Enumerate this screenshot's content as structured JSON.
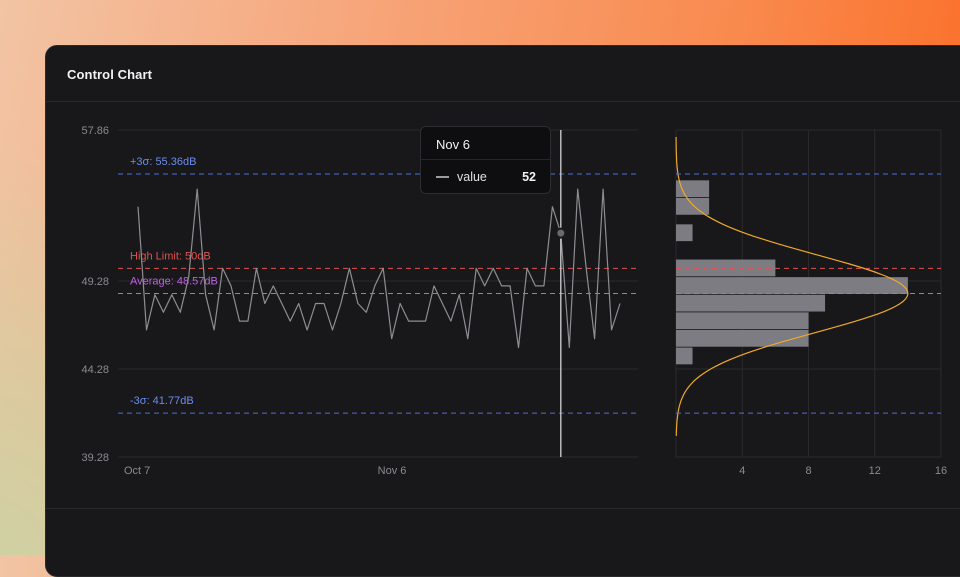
{
  "card": {
    "title": "Control Chart"
  },
  "tooltip": {
    "date": "Nov 6",
    "series": "value",
    "value": "52"
  },
  "colors": {
    "series": "#8e8e92",
    "sigma": "#4a6fe0",
    "sigma_text": "#6b8cf0",
    "high_limit": "#e0524f",
    "average": "#c25ee8",
    "bell": "#f0a92a",
    "bars": "#7c7c82",
    "grid": "#2a2a2d",
    "axis_text": "#8a8a8f"
  },
  "chart_data": [
    {
      "type": "line",
      "x_labels": [
        "Oct 7",
        "Nov 6"
      ],
      "x_label_index": [
        0,
        30
      ],
      "ylim": [
        39.28,
        57.86
      ],
      "y_ticks": [
        "57.86",
        "49.28",
        "44.28",
        "39.28"
      ],
      "y_tick_values": [
        57.86,
        49.28,
        44.28,
        39.28
      ],
      "values": [
        53.5,
        46.5,
        48.5,
        47.5,
        48.5,
        47.5,
        49.5,
        54.5,
        48.5,
        46.5,
        50.0,
        49.0,
        47.0,
        47.0,
        50.0,
        48.0,
        49.0,
        48.0,
        47.0,
        48.0,
        46.5,
        48.0,
        48.0,
        46.5,
        48.0,
        50.0,
        48.0,
        47.5,
        49.0,
        50.0,
        46.0,
        48.0,
        47.0,
        47.0,
        47.0,
        49.0,
        48.0,
        47.0,
        48.5,
        46.0,
        50.0,
        49.0,
        50.0,
        49.0,
        49.0,
        45.5,
        50.0,
        49.0,
        49.0,
        53.5,
        52.0,
        45.5,
        54.5,
        50.0,
        46.0,
        54.5,
        46.5,
        48.0
      ],
      "highlight_index": 50,
      "reference_lines": [
        {
          "label": "+3σ: 55.36dB",
          "value": 55.36,
          "kind": "sigma"
        },
        {
          "label": "High Limit: 50dB",
          "value": 50,
          "kind": "high_limit"
        },
        {
          "label": "Average: 48.57dB",
          "value": 48.57,
          "kind": "average"
        },
        {
          "label": "-3σ: 41.77dB",
          "value": 41.77,
          "kind": "sigma"
        }
      ]
    },
    {
      "type": "bar",
      "orientation": "horizontal",
      "x_ticks": [
        "4",
        "8",
        "12",
        "16"
      ],
      "x_tick_values": [
        4,
        8,
        12,
        16
      ],
      "xlim": [
        0,
        16
      ],
      "bins": [
        {
          "y0": 54.0,
          "y1": 55.0,
          "count": 2
        },
        {
          "y0": 53.0,
          "y1": 54.0,
          "count": 2
        },
        {
          "y0": 51.5,
          "y1": 52.5,
          "count": 1
        },
        {
          "y0": 49.5,
          "y1": 50.5,
          "count": 6
        },
        {
          "y0": 48.5,
          "y1": 49.5,
          "count": 14
        },
        {
          "y0": 47.5,
          "y1": 48.5,
          "count": 9
        },
        {
          "y0": 46.5,
          "y1": 47.5,
          "count": 8
        },
        {
          "y0": 45.5,
          "y1": 46.5,
          "count": 8
        },
        {
          "y0": 44.5,
          "y1": 45.5,
          "count": 1
        }
      ],
      "normal_curve": {
        "mean": 48.57,
        "sigma": 2.2,
        "peak": 14
      }
    }
  ]
}
